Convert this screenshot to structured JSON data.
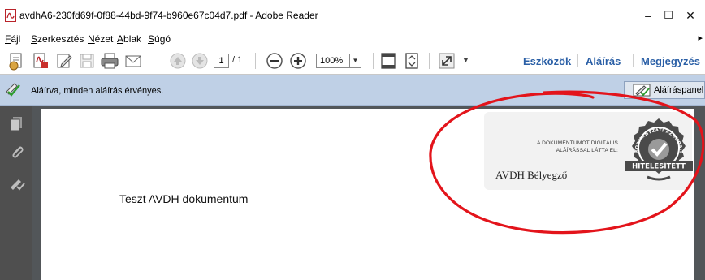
{
  "window": {
    "title": "avdhA6-230fd69f-0f88-44bd-9f74-b960e67c04d7.pdf - Adobe Reader",
    "minimize_glyph": "–",
    "maximize_glyph": "☐",
    "close_glyph": "✕"
  },
  "menu": {
    "items": [
      {
        "accel": "F",
        "rest": "ájl"
      },
      {
        "accel": "S",
        "rest": "zerkesztés"
      },
      {
        "accel": "N",
        "rest": "ézet"
      },
      {
        "accel": "A",
        "rest": "blak"
      },
      {
        "accel": "S",
        "rest": "úgó"
      }
    ],
    "more_glyph": "▸"
  },
  "toolbar": {
    "icons": [
      "create-pdf-icon",
      "convert-pdf-icon",
      "edit-icon",
      "save-icon",
      "print-icon",
      "email-icon",
      "previous-page-icon",
      "next-page-icon",
      "zoom-out-icon",
      "zoom-in-icon",
      "fit-page-icon",
      "fit-width-icon",
      "fullscreen-icon"
    ],
    "page_current": "1",
    "page_total": "/ 1",
    "zoom_value": "100%",
    "dropdown_glyph": "▼",
    "more_glyph": "▼",
    "links": {
      "tools": "Eszközök",
      "sign": "Aláírás",
      "comment": "Megjegyzés"
    }
  },
  "signature_bar": {
    "message": "Aláírva, minden aláírás érvényes.",
    "panel_button": "Aláíráspanel"
  },
  "document": {
    "body_text": "Teszt AVDH dokumentum",
    "stamp": {
      "line1": "A DOKUMENTUMOT DIGITÁLIS",
      "line2": "ALÁÍRÁSSAL LÁTTA EL:",
      "name": "AVDH Bélyegző",
      "seal_arc": "KORMÁNYZATI AZONOSÍTÁSSAL",
      "seal_banner": "HITELESÍTETT"
    }
  },
  "colors": {
    "link_blue": "#2a5fa6",
    "sigbar_bg": "#bfd0e6",
    "annotation_red": "#e3141b"
  }
}
